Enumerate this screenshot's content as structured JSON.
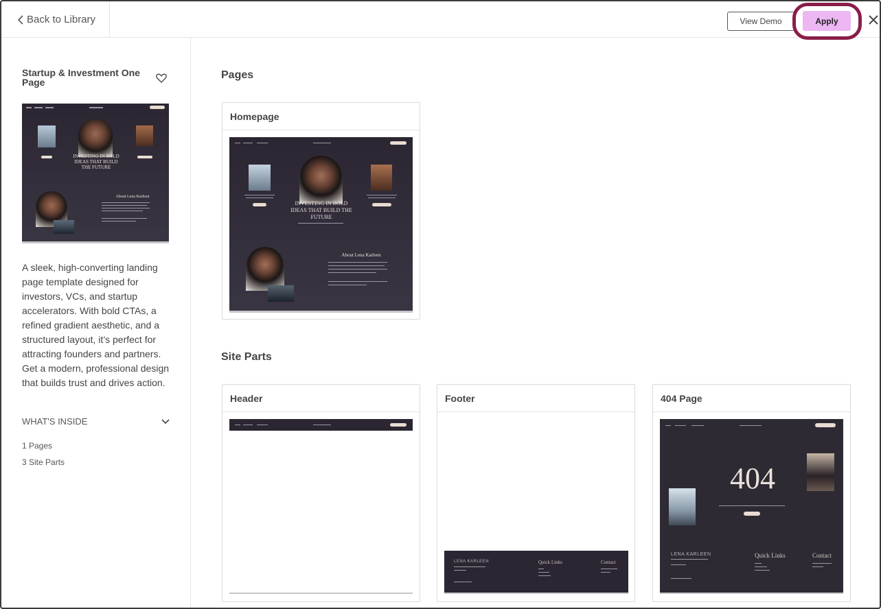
{
  "topbar": {
    "back_label": "Back to Library",
    "view_demo_label": "View Demo",
    "apply_label": "Apply"
  },
  "sidebar": {
    "title": "Startup & Investment One Page",
    "description": "A sleek, high-converting landing page template designed for investors, VCs, and startup accelerators. With bold CTAs, a refined gradient aesthetic, and a structured layout, it’s perfect for attracting founders and partners. Get a modern, professional design that builds trust and drives action.",
    "whats_inside_label": "WHAT'S INSIDE",
    "pages_count": "1 Pages",
    "site_parts_count": "3 Site Parts"
  },
  "preview_text": {
    "hero_heading": "INVESTING IN BOLD IDEAS THAT BUILD THE FUTURE",
    "about_heading": "About Lena Karleen",
    "logo": "LENA KARLEEN",
    "quick_links": "Quick Links",
    "contact": "Contact",
    "error_code": "404"
  },
  "main": {
    "pages_title": "Pages",
    "site_parts_title": "Site Parts",
    "pages": [
      {
        "label": "Homepage"
      }
    ],
    "site_parts": [
      {
        "label": "Header"
      },
      {
        "label": "Footer"
      },
      {
        "label": "404 Page"
      }
    ]
  },
  "colors": {
    "apply_bg": "#ecb7f2",
    "highlight_ring": "#8a1d4a",
    "template_dark": "#2b2632"
  }
}
